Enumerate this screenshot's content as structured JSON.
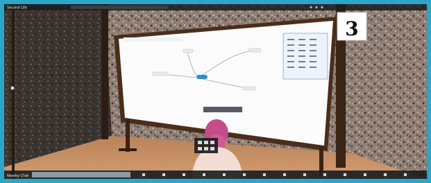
{
  "viewer": {
    "window_title": "Second Life",
    "location_label": "Nearby Chat"
  },
  "board": {
    "number_sign": "3",
    "mindmap_nodes": [
      {
        "label": "",
        "kind": "center"
      },
      {
        "label": "",
        "kind": "child"
      },
      {
        "label": "",
        "kind": "child"
      },
      {
        "label": "",
        "kind": "child"
      },
      {
        "label": "",
        "kind": "child"
      }
    ],
    "caption": ""
  },
  "toolbar": {
    "buttons": [
      {
        "icon": "avatar-icon"
      },
      {
        "icon": "gesture-icon"
      },
      {
        "icon": "walk-icon"
      },
      {
        "icon": "fly-icon"
      },
      {
        "icon": "camera-icon"
      },
      {
        "icon": "map-icon"
      },
      {
        "icon": "minimap-icon"
      },
      {
        "icon": "search-icon"
      },
      {
        "icon": "people-icon"
      },
      {
        "icon": "places-icon"
      },
      {
        "icon": "snapshot-icon"
      },
      {
        "icon": "voice-icon"
      },
      {
        "icon": "build-icon"
      },
      {
        "icon": "settings-icon"
      }
    ]
  },
  "colors": {
    "frame": "#2aa6c9",
    "floor": "#c48f63",
    "whiteboard": "#fbfbfb",
    "board_frame": "#4a2e1b",
    "avatar_hair": "#c24d88"
  }
}
